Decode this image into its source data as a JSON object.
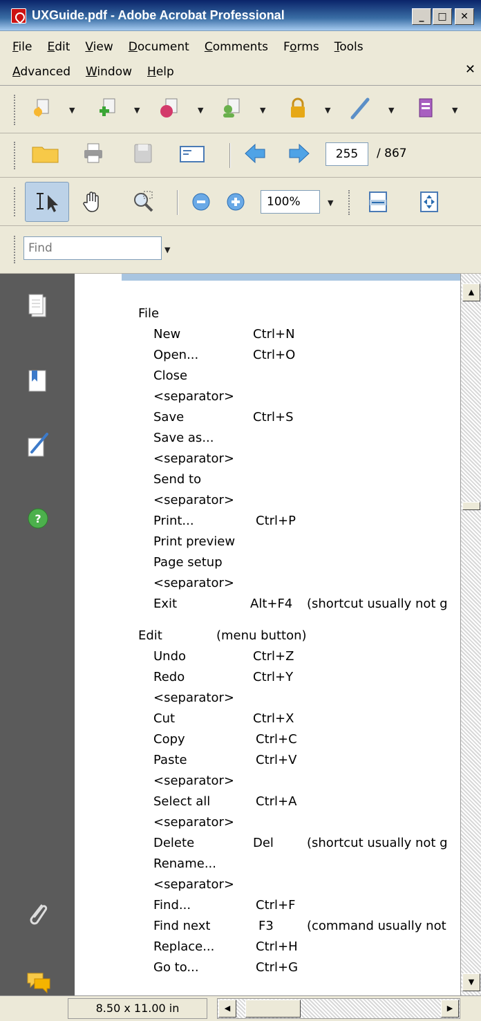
{
  "window": {
    "title": "UXGuide.pdf - Adobe Acrobat Professional",
    "minimize": "_",
    "maximize": "□",
    "close": "✕"
  },
  "menu": {
    "row1": [
      "File",
      "Edit",
      "View",
      "Document",
      "Comments",
      "Forms",
      "Tools"
    ],
    "row2": [
      "Advanced",
      "Window",
      "Help"
    ],
    "doc_close": "✕"
  },
  "toolbar": {
    "current_page": "255",
    "total_pages": "/ 867",
    "zoom": "100%",
    "find_placeholder": "Find"
  },
  "document": {
    "lines": [
      {
        "a": "File",
        "b": "",
        "c": "",
        "indent": 0
      },
      {
        "a": "New",
        "b": "Ctrl+N",
        "c": "",
        "indent": 1
      },
      {
        "a": "Open...",
        "b": "Ctrl+O",
        "c": "",
        "indent": 1
      },
      {
        "a": "Close",
        "b": "",
        "c": "",
        "indent": 1
      },
      {
        "a": "<separator>",
        "b": "",
        "c": "",
        "indent": 1
      },
      {
        "a": "Save",
        "b": "Ctrl+S",
        "c": "",
        "indent": 1
      },
      {
        "a": "Save as...",
        "b": "",
        "c": "",
        "indent": 1
      },
      {
        "a": "<separator>",
        "b": "",
        "c": "",
        "indent": 1
      },
      {
        "a": "Send to",
        "b": "",
        "c": "",
        "indent": 1
      },
      {
        "a": "<separator>",
        "b": "",
        "c": "",
        "indent": 1
      },
      {
        "a": "Print...",
        "b": "Ctrl+P",
        "c": "",
        "indent": 1
      },
      {
        "a": "Print preview",
        "b": "",
        "c": "",
        "indent": 1
      },
      {
        "a": "Page setup",
        "b": "",
        "c": "",
        "indent": 1
      },
      {
        "a": "<separator>",
        "b": "",
        "c": "",
        "indent": 1
      },
      {
        "a": "Exit",
        "b": "Alt+F4",
        "c": "(shortcut usually not g",
        "indent": 1
      },
      {
        "a": "Edit",
        "b": "(menu button)",
        "c": "",
        "indent": 0
      },
      {
        "a": "Undo",
        "b": "Ctrl+Z",
        "c": "",
        "indent": 1
      },
      {
        "a": "Redo",
        "b": "Ctrl+Y",
        "c": "",
        "indent": 1
      },
      {
        "a": "<separator>",
        "b": "",
        "c": "",
        "indent": 1
      },
      {
        "a": "Cut",
        "b": "Ctrl+X",
        "c": "",
        "indent": 1
      },
      {
        "a": "Copy",
        "b": "Ctrl+C",
        "c": "",
        "indent": 1
      },
      {
        "a": "Paste",
        "b": "Ctrl+V",
        "c": "",
        "indent": 1
      },
      {
        "a": "<separator>",
        "b": "",
        "c": "",
        "indent": 1
      },
      {
        "a": "Select all",
        "b": "Ctrl+A",
        "c": "",
        "indent": 1
      },
      {
        "a": "<separator>",
        "b": "",
        "c": "",
        "indent": 1
      },
      {
        "a": "Delete",
        "b": "Del",
        "c": "(shortcut usually not g",
        "indent": 1
      },
      {
        "a": "Rename...",
        "b": "",
        "c": "",
        "indent": 1
      },
      {
        "a": "<separator>",
        "b": "",
        "c": "",
        "indent": 1
      },
      {
        "a": "Find...",
        "b": "Ctrl+F",
        "c": "",
        "indent": 1
      },
      {
        "a": "Find next",
        "b": "F3",
        "c": "(command usually not",
        "indent": 1
      },
      {
        "a": "Replace...",
        "b": "Ctrl+H",
        "c": "",
        "indent": 1
      },
      {
        "a": "Go to...",
        "b": "Ctrl+G",
        "c": "",
        "indent": 1
      }
    ]
  },
  "status": {
    "page_size": "8.50 x 11.00 in"
  },
  "colors": {
    "title_bar": "#0a246a",
    "chrome": "#ece9d8",
    "nav_panel": "#5b5b5b",
    "doc_header_band": "#a9c5e0"
  }
}
